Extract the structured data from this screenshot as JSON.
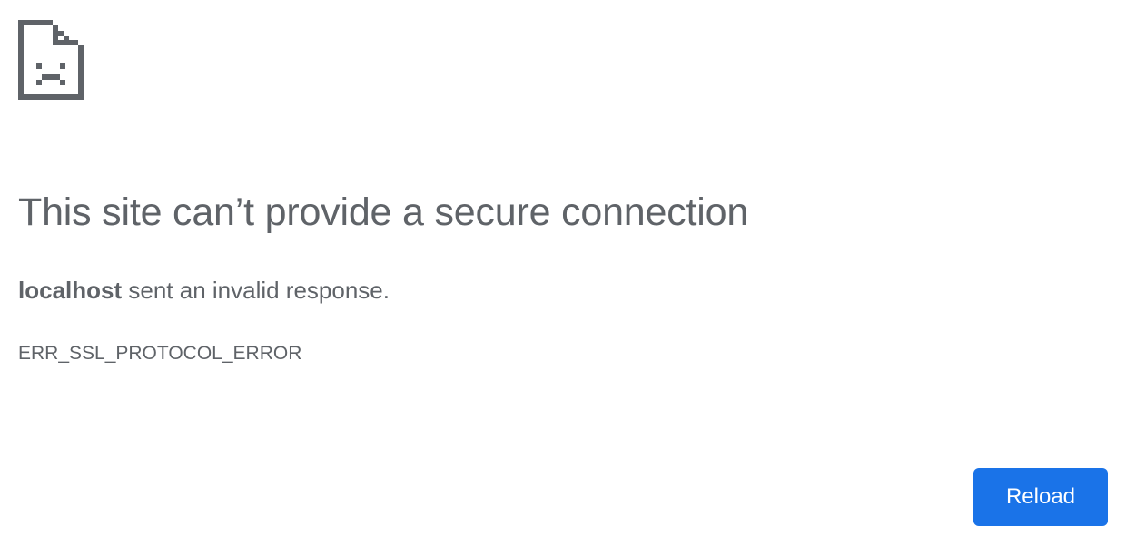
{
  "icon": {
    "name": "sad-document-icon",
    "color": "#5f6368"
  },
  "title": "This site can’t provide a secure connection",
  "summary": {
    "host": "localhost",
    "message": " sent an invalid response."
  },
  "error_code": "ERR_SSL_PROTOCOL_ERROR",
  "reload_button": {
    "label": "Reload",
    "color": "#1a73e8"
  }
}
